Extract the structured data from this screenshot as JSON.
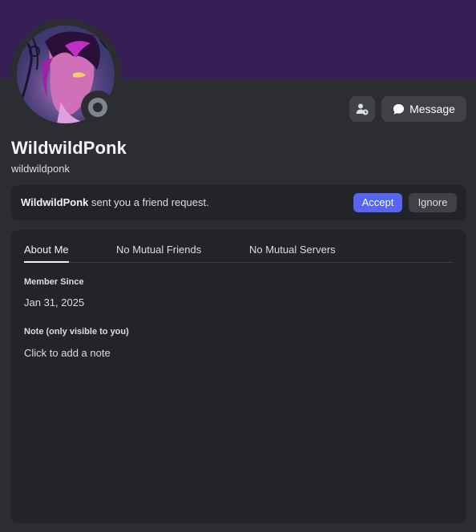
{
  "profile": {
    "display_name": "WildwildPonk",
    "username": "wildwildponk",
    "status": "offline",
    "banner_color": "#371e55"
  },
  "actions": {
    "add_friend_icon": "user-pending-icon",
    "message_icon": "speech-bubble-icon",
    "message_label": "Message"
  },
  "friend_request": {
    "sender": "WildwildPonk",
    "text": " sent you a friend request.",
    "accept_label": "Accept",
    "ignore_label": "Ignore",
    "accept_color": "#5865f2"
  },
  "tabs": [
    {
      "label": "About Me",
      "active": true
    },
    {
      "label": "No Mutual Friends",
      "active": false
    },
    {
      "label": "No Mutual Servers",
      "active": false
    }
  ],
  "about": {
    "member_since_label": "Member Since",
    "member_since_value": "Jan 31, 2025",
    "note_label": "Note (only visible to you)",
    "note_placeholder": "Click to add a note"
  }
}
